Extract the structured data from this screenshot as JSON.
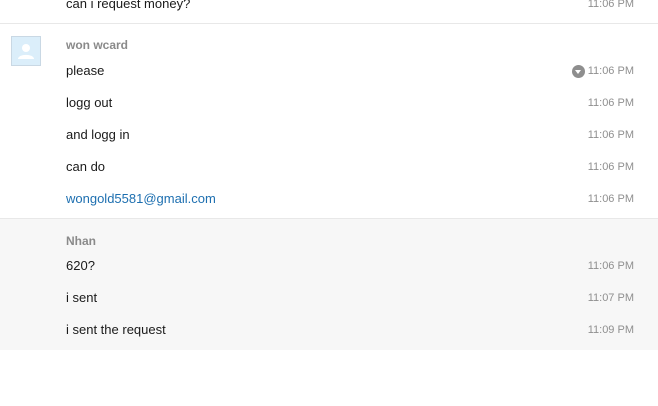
{
  "top_message": {
    "text": "can i request money?",
    "time": "11:06 PM"
  },
  "groups": {
    "won": {
      "sender": "won wcard",
      "avatar_icon": "default-user-avatar-icon",
      "messages": [
        {
          "text": "please",
          "time": "11:06 PM"
        },
        {
          "text": "logg out",
          "time": "11:06 PM"
        },
        {
          "text": "and logg in",
          "time": "11:06 PM"
        },
        {
          "text": "can do",
          "time": "11:06 PM"
        },
        {
          "text": "wongold5581@gmail.com",
          "time": "11:06 PM"
        }
      ]
    },
    "nhan": {
      "sender": "Nhan",
      "messages": [
        {
          "text": "620?",
          "time": "11:06 PM"
        },
        {
          "text": "i sent",
          "time": "11:07 PM"
        },
        {
          "text": "i sent the request",
          "time": "11:09 PM"
        }
      ]
    }
  },
  "colors": {
    "link": "#1d6fb0",
    "timestamp": "#8f8f8f",
    "sender": "#8a8a8a",
    "highlight_block": "#f7f7f7"
  }
}
